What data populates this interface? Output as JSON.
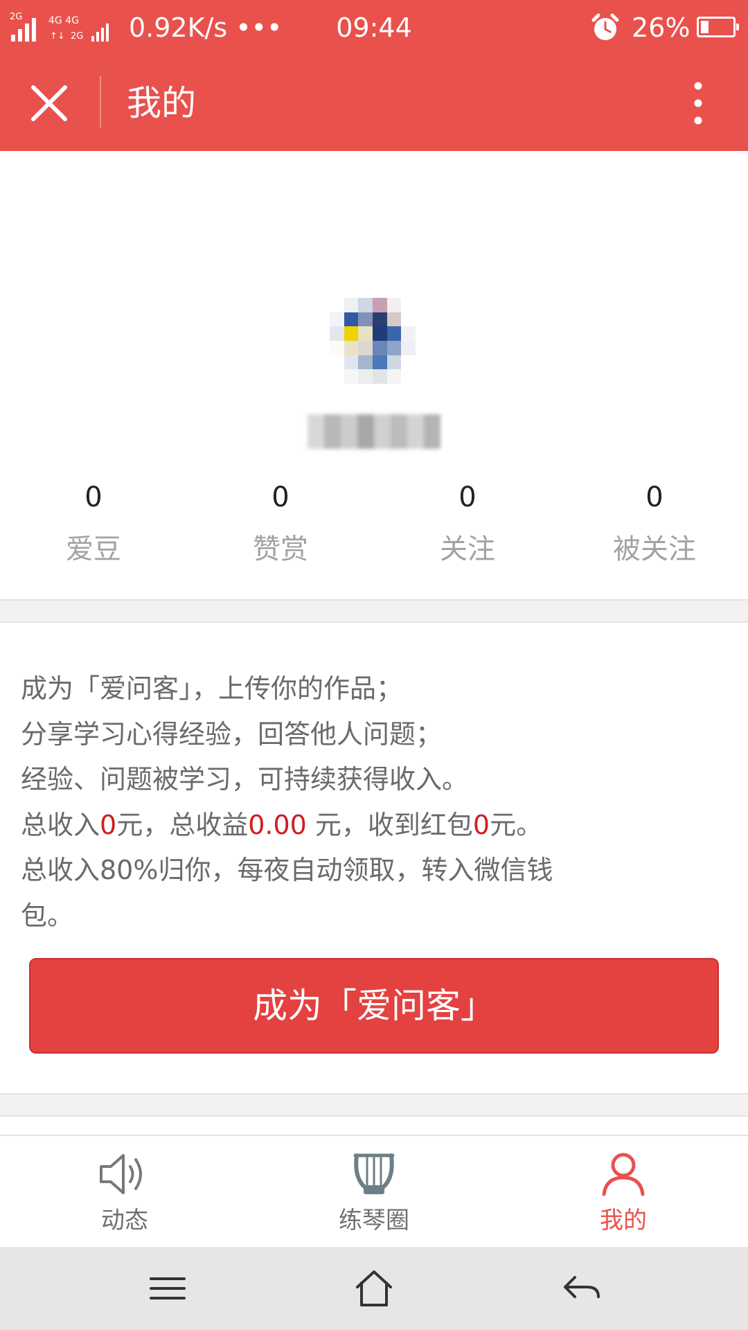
{
  "status_bar": {
    "signal_text": "2G",
    "network_badge_top": "4G 4G",
    "network_badge_bottom": "2G",
    "net_speed": "0.92K/s •••",
    "time": "09:44",
    "battery_percent": "26%",
    "battery_level": 0.26
  },
  "header": {
    "title": "我的"
  },
  "profile": {
    "stats": [
      {
        "value": "0",
        "label": "爱豆"
      },
      {
        "value": "0",
        "label": "赞赏"
      },
      {
        "value": "0",
        "label": "关注"
      },
      {
        "value": "0",
        "label": "被关注"
      }
    ]
  },
  "promo": {
    "line1": "成为「爱问客」，上传你的作品；",
    "line2": "分享学习心得经验，回答他人问题；",
    "line3": "经验、问题被学习，可持续获得收入。",
    "line4": {
      "p1": "总收入",
      "v1": "0",
      "p2": "元，总收益",
      "v2": "0.00",
      "p3": " 元，收到红包",
      "v3": "0",
      "p4": "元。"
    },
    "line5": "总收入80%归你，每夜自动领取，转入微信钱",
    "line6": "包。",
    "button_label": "成为「爱问客」"
  },
  "tabs": [
    {
      "label": "动态",
      "icon": "speaker-icon",
      "active": false
    },
    {
      "label": "练琴圈",
      "icon": "lyre-icon",
      "active": false
    },
    {
      "label": "我的",
      "icon": "person-icon",
      "active": true
    }
  ],
  "colors": {
    "brand_red": "#e9514d",
    "amount_red": "#d01e1e",
    "button_red": "#e34240"
  }
}
